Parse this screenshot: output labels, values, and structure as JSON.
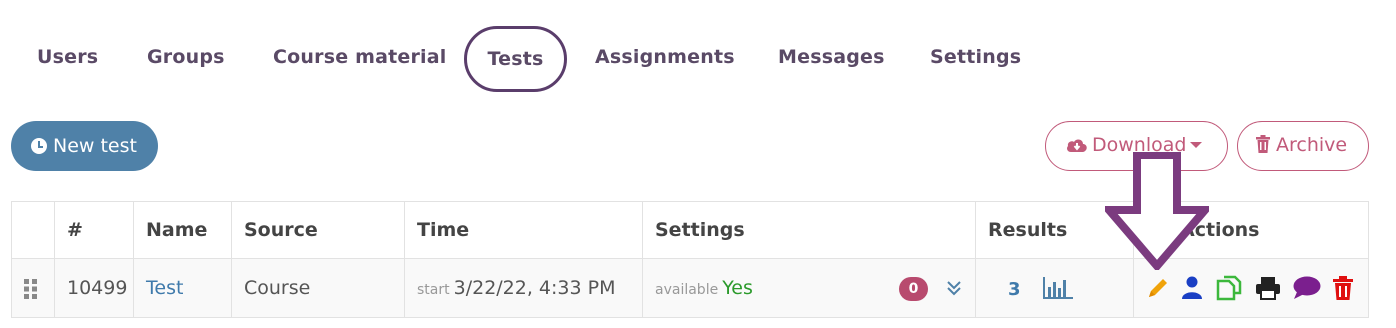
{
  "tabs": [
    {
      "label": "Users",
      "active": false
    },
    {
      "label": "Groups",
      "active": false
    },
    {
      "label": "Course material",
      "active": false
    },
    {
      "label": "Tests",
      "active": true
    },
    {
      "label": "Assignments",
      "active": false
    },
    {
      "label": "Messages",
      "active": false
    },
    {
      "label": "Settings",
      "active": false
    }
  ],
  "toolbar": {
    "new_test_label": "New test",
    "download_label": "Download",
    "archive_label": "Archive"
  },
  "table": {
    "headers": {
      "hash": "#",
      "name": "Name",
      "source": "Source",
      "time": "Time",
      "settings": "Settings",
      "results": "Results",
      "actions": "Actions"
    },
    "rows": [
      {
        "id": "10499",
        "name": "Test",
        "source": "Course",
        "time_prefix": "start",
        "time_value": "3/22/22, 4:33 PM",
        "settings_prefix": "available",
        "settings_value": "Yes",
        "badge_count": "0",
        "results_count": "3"
      }
    ]
  },
  "icons": {
    "drag_handle": "drag-handle-icon",
    "expand": "double-chevron-down-icon",
    "chart": "bar-chart-icon",
    "edit": "pencil-icon",
    "user": "user-icon",
    "copy": "copy-icon",
    "print": "print-icon",
    "comment": "comment-icon",
    "delete": "trash-icon",
    "cloud": "cloud-download-icon",
    "overlay": "down-arrow-annotation"
  },
  "colors": {
    "primary": "#4f81a8",
    "accent": "#c15a7a",
    "tab_border": "#5a3d6b",
    "annotation": "#7b3b7f",
    "edit": "#f0a30a",
    "user": "#1a3fc4",
    "copy": "#3cb83c",
    "comment": "#7b1f8e",
    "delete": "#e01010"
  }
}
